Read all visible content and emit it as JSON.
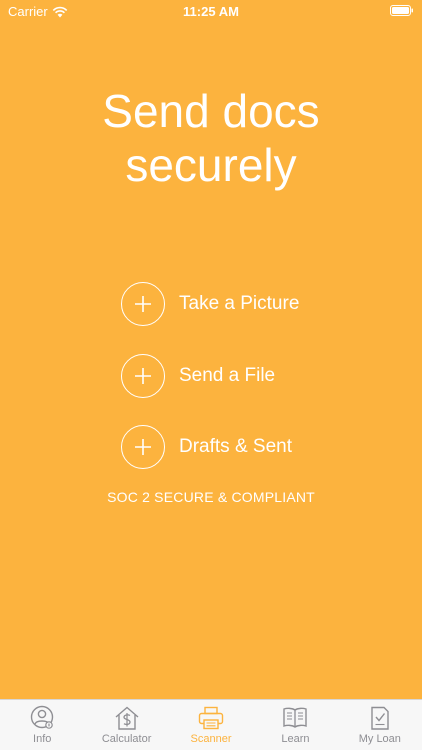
{
  "status_bar": {
    "carrier": "Carrier",
    "time": "11:25 AM"
  },
  "headline": {
    "line1": "Send docs",
    "line2": "securely"
  },
  "actions": [
    {
      "label": "Take a Picture",
      "icon": "plus-circle-icon"
    },
    {
      "label": "Send a File",
      "icon": "plus-circle-icon"
    },
    {
      "label": "Drafts & Sent",
      "icon": "plus-circle-icon"
    }
  ],
  "compliance_text": "SOC 2 SECURE & COMPLIANT",
  "tab_bar": {
    "active": "Scanner",
    "tabs": [
      {
        "label": "Info",
        "icon": "person-icon"
      },
      {
        "label": "Calculator",
        "icon": "house-dollar-icon"
      },
      {
        "label": "Scanner",
        "icon": "printer-icon"
      },
      {
        "label": "Learn",
        "icon": "book-icon"
      },
      {
        "label": "My Loan",
        "icon": "document-check-icon"
      }
    ]
  },
  "colors": {
    "background": "#FCB33E",
    "tab_active": "#FCB33E",
    "tab_inactive": "#8e8e93",
    "tab_bar_bg": "#f7f7f7"
  }
}
